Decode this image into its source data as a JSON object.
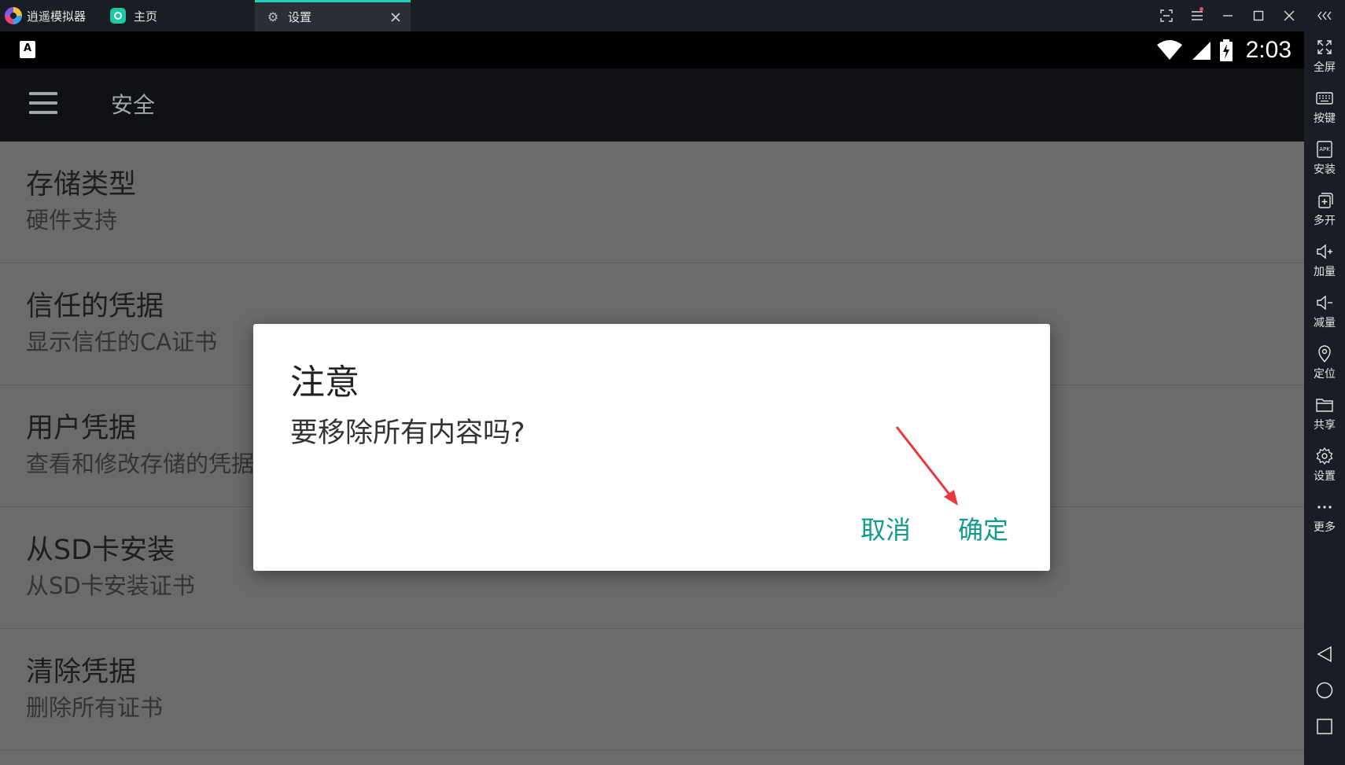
{
  "emulator": {
    "app_name": "逍遥模拟器",
    "tabs": [
      {
        "label": "主页"
      },
      {
        "label": "设置"
      }
    ]
  },
  "android": {
    "status": {
      "input_indicator": "A",
      "time": "2:03"
    },
    "appbar": {
      "title": "安全"
    },
    "list": [
      {
        "title": "存储类型",
        "subtitle": "硬件支持"
      },
      {
        "title": "信任的凭据",
        "subtitle": "显示信任的CA证书"
      },
      {
        "title": "用户凭据",
        "subtitle": "查看和修改存储的凭据"
      },
      {
        "title": "从SD卡安装",
        "subtitle": "从SD卡安装证书"
      },
      {
        "title": "清除凭据",
        "subtitle": "删除所有证书"
      }
    ],
    "dialog": {
      "title": "注意",
      "message": "要移除所有内容吗?",
      "cancel_label": "取消",
      "confirm_label": "确定"
    }
  },
  "sidebar": {
    "items": [
      {
        "label": "全屏",
        "icon": "fullscreen-icon"
      },
      {
        "label": "按键",
        "icon": "keyboard-icon"
      },
      {
        "label": "安装",
        "icon": "apk-icon"
      },
      {
        "label": "多开",
        "icon": "multi-instance-icon"
      },
      {
        "label": "加量",
        "icon": "volume-up-icon"
      },
      {
        "label": "减量",
        "icon": "volume-down-icon"
      },
      {
        "label": "定位",
        "icon": "location-icon"
      },
      {
        "label": "共享",
        "icon": "folder-icon"
      },
      {
        "label": "设置",
        "icon": "gear-icon"
      },
      {
        "label": "更多",
        "icon": "more-icon"
      }
    ]
  },
  "colors": {
    "accent": "#129b8c",
    "tab_indicator": "#1fd0b7",
    "annotation_arrow": "#e8383d"
  }
}
